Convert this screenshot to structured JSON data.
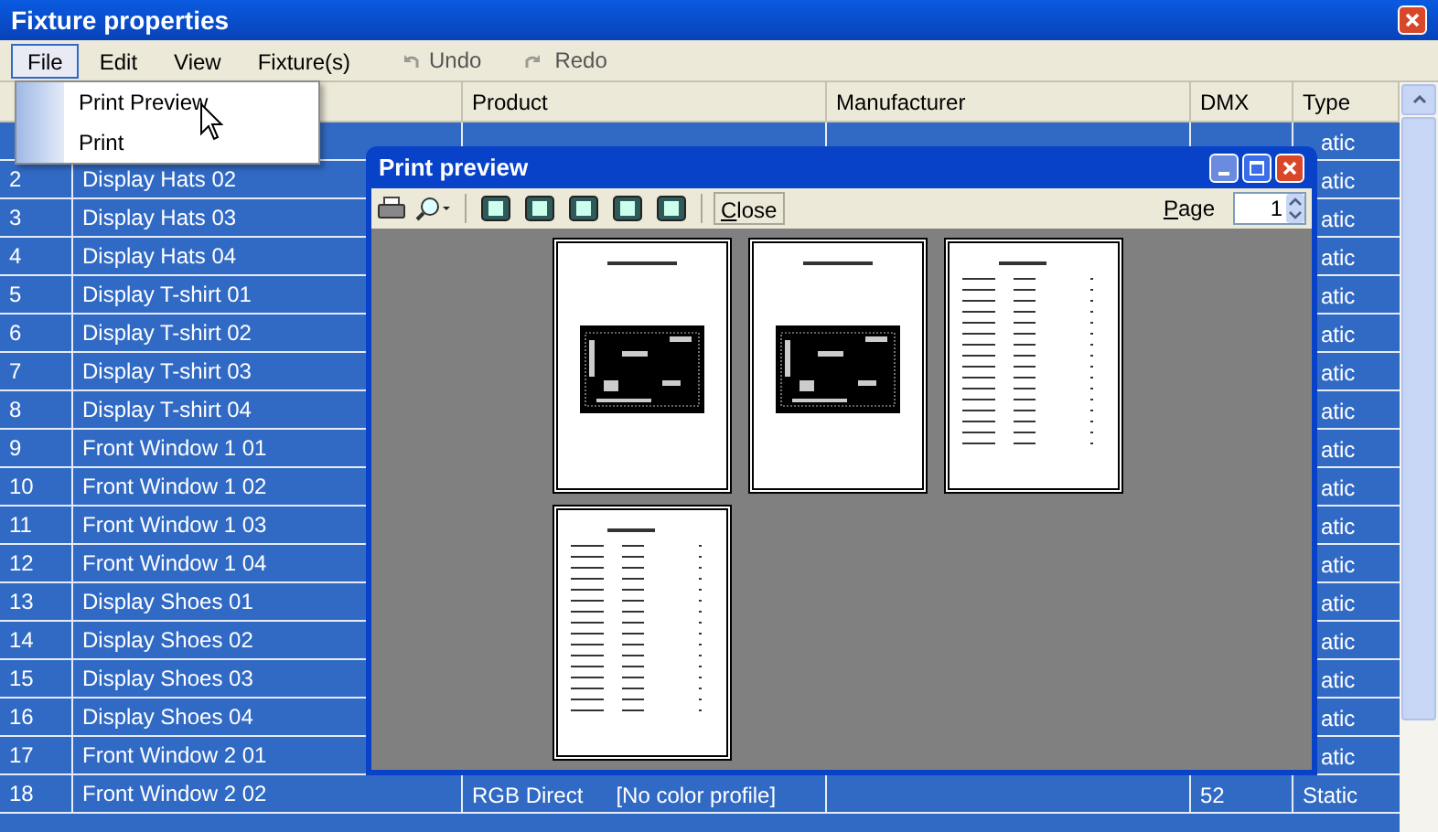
{
  "window": {
    "title": "Fixture properties"
  },
  "menu": [
    {
      "label": "File",
      "selected": true
    },
    {
      "label": "Edit",
      "selected": false
    },
    {
      "label": "View",
      "selected": false
    },
    {
      "label": "Fixture(s)",
      "selected": false
    }
  ],
  "toolbar": [
    {
      "label": "Undo",
      "kind": "undo",
      "disabled": true
    },
    {
      "label": "Redo",
      "kind": "redo",
      "disabled": true
    }
  ],
  "file_menu": {
    "items": [
      "Print Preview",
      "Print"
    ]
  },
  "table": {
    "columns": [
      "Product",
      "Manufacturer",
      "DMX",
      "Type"
    ],
    "rows": [
      {
        "type": "atic"
      },
      {
        "number": "2",
        "name": "Display Hats 02",
        "type": "atic"
      },
      {
        "number": "3",
        "name": "Display Hats 03",
        "type": "atic"
      },
      {
        "number": "4",
        "name": "Display Hats 04",
        "type": "atic"
      },
      {
        "number": "5",
        "name": "Display T-shirt 01",
        "type": "atic"
      },
      {
        "number": "6",
        "name": "Display T-shirt 02",
        "type": "atic"
      },
      {
        "number": "7",
        "name": "Display T-shirt 03",
        "type": "atic"
      },
      {
        "number": "8",
        "name": "Display T-shirt 04",
        "type": "atic"
      },
      {
        "number": "9",
        "name": "Front Window 1 01",
        "type": "atic"
      },
      {
        "number": "10",
        "name": "Front Window 1 02",
        "type": "atic"
      },
      {
        "number": "11",
        "name": "Front Window 1 03",
        "type": "atic"
      },
      {
        "number": "12",
        "name": "Front Window 1 04",
        "type": "atic"
      },
      {
        "number": "13",
        "name": "Display Shoes 01",
        "type": "atic"
      },
      {
        "number": "14",
        "name": "Display Shoes 02",
        "type": "atic"
      },
      {
        "number": "15",
        "name": "Display Shoes 03",
        "type": "atic"
      },
      {
        "number": "16",
        "name": "Display Shoes 04",
        "type": "atic"
      },
      {
        "number": "17",
        "name": "Front Window 2 01",
        "type": "atic"
      },
      {
        "number": "18",
        "name": "Front Window 2 02",
        "product": "RGB Direct",
        "color_profile": "[No color profile]",
        "dmx": "52",
        "type": "Static"
      }
    ]
  },
  "print_preview": {
    "title": "Print preview",
    "close": "Close",
    "page_label": "Page",
    "page_value": "1",
    "pages": [
      {
        "kind": "diagram"
      },
      {
        "kind": "diagram"
      },
      {
        "kind": "list"
      },
      {
        "kind": "list"
      }
    ]
  }
}
